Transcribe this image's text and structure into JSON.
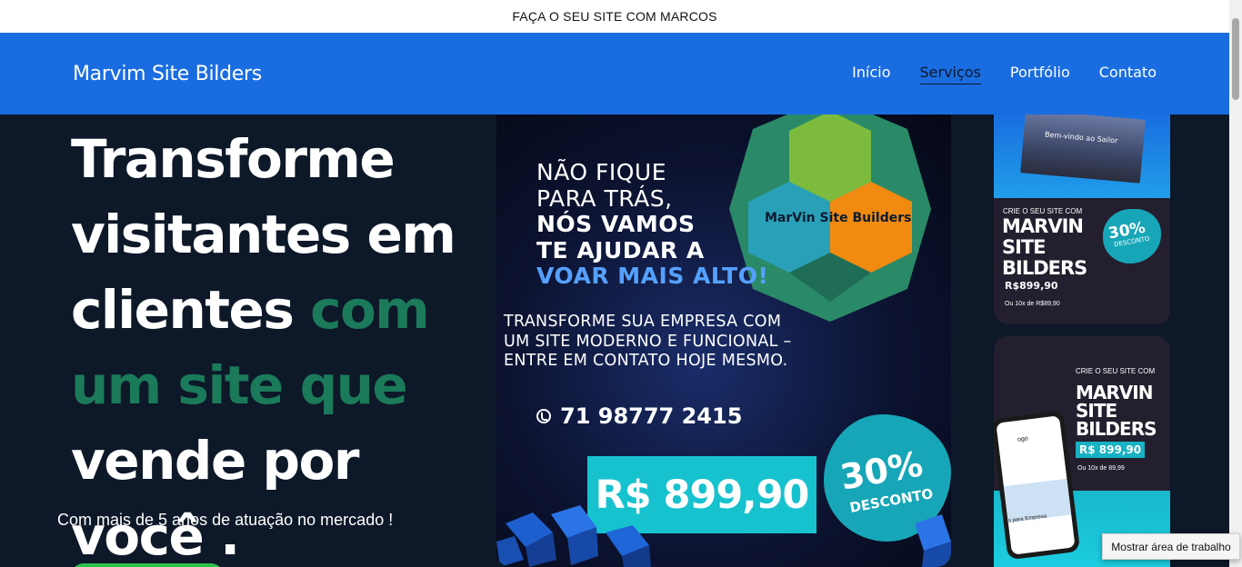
{
  "topbar": {
    "text": "FAÇA O SEU SITE COM MARCOS"
  },
  "header": {
    "brand": "Marvim Site Bilders",
    "nav": [
      {
        "label": "Início"
      },
      {
        "label": "Serviços",
        "active": true
      },
      {
        "label": "Portfólio"
      },
      {
        "label": "Contato"
      }
    ]
  },
  "hero": {
    "headline_1": "Transforme visitantes em clientes",
    "headline_accent": "com um site que",
    "headline_2": "vende por você .",
    "subtitle": "Com mais de 5 anos de atuação no mercado !"
  },
  "banner": {
    "title_line1": "NÃO FIQUE",
    "title_line2": "PARA TRÁS,",
    "title_line3": "NÓS VAMOS",
    "title_line4": "TE AJUDAR A",
    "title_line5": "VOAR MAIS ALTO!",
    "logo_text": "MarVin Site Builders",
    "desc_line1": "TRANSFORME SUA EMPRESA COM",
    "desc_line2": "UM SITE MODERNO E FUNCIONAL  –",
    "desc_line3": "ENTRE EM CONTATO HOJE MESMO.",
    "phone": "71 98777 2415",
    "price": "R$ 899,90",
    "discount_pct": "30%",
    "discount_label": "DESCONTO"
  },
  "card1": {
    "screen_title": "Bem-vindo ao Sailor",
    "small": "CRIE O SEU SITE COM",
    "big_line1": "MARVIN",
    "big_line2": "SITE",
    "big_line3": "BILDERS",
    "price": "R$899,90",
    "installments": "Ou 10x de R$89,90",
    "badge_pct": "30%",
    "badge_label": "DESCONTO"
  },
  "card2": {
    "small": "CRIE O SEU SITE COM",
    "big_line1": "MARVIN",
    "big_line2": "SITE",
    "big_line3": "BILDERS",
    "price": "R$ 899,90",
    "installments": "Ou 10x de 89,99",
    "phone_title": "ogo",
    "phone_caption": "s para Empresa"
  },
  "tooltip": {
    "text": "Mostrar área de trabalho"
  }
}
